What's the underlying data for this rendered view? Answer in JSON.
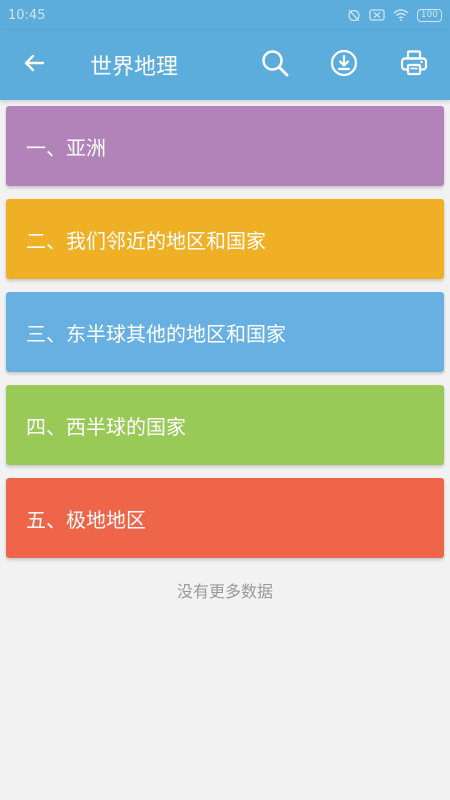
{
  "status_bar": {
    "time": "10:45",
    "battery": "100"
  },
  "header": {
    "title": "世界地理",
    "icons": [
      "back-arrow-icon",
      "search-icon",
      "download-icon",
      "print-icon"
    ]
  },
  "chapters": [
    {
      "label": "一、亚洲",
      "color": "#b283b8"
    },
    {
      "label": "二、我们邻近的地区和国家",
      "color": "#efb025"
    },
    {
      "label": "三、东半球其他的地区和国家",
      "color": "#68b0e2"
    },
    {
      "label": "四、西半球的国家",
      "color": "#99ca58"
    },
    {
      "label": "五、极地地区",
      "color": "#ee6549"
    }
  ],
  "footer_text": "没有更多数据",
  "colors": {
    "accent": "#5cacdc",
    "background": "#f2f2f2"
  }
}
